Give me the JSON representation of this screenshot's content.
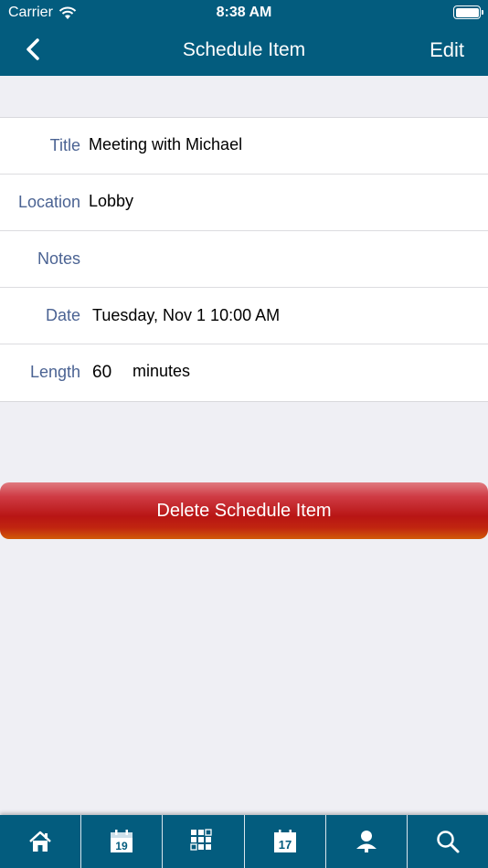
{
  "status_bar": {
    "carrier": "Carrier",
    "time": "8:38 AM"
  },
  "nav": {
    "title": "Schedule Item",
    "edit_label": "Edit"
  },
  "fields": {
    "title_label": "Title",
    "title_value": "Meeting with Michael",
    "location_label": "Location",
    "location_value": "Lobby",
    "notes_label": "Notes",
    "notes_value": "",
    "date_label": "Date",
    "date_value": "Tuesday, Nov 1 10:00 AM",
    "length_label": "Length",
    "length_value": "60",
    "length_units": "minutes"
  },
  "actions": {
    "delete_label": "Delete Schedule Item"
  },
  "tabs": {
    "calendar_day": "19",
    "calendar2_day": "17",
    "icons": [
      "home-icon",
      "calendar-icon",
      "grid-icon",
      "schedule-icon",
      "person-icon",
      "search-icon"
    ]
  },
  "colors": {
    "bar": "#035c7e",
    "label": "#4b6393",
    "delete": "#b81514"
  }
}
